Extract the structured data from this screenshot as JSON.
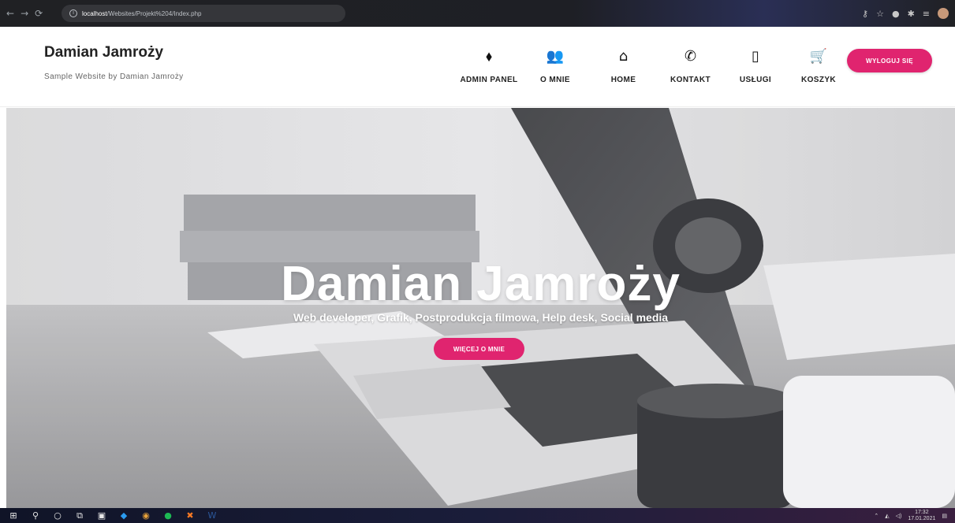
{
  "browser": {
    "nav": {
      "back": "←",
      "forward": "→",
      "reload": "⟳"
    },
    "url_host": "localhost",
    "url_path": "/Websites/Projekt%204/Index.php",
    "extension_icons": [
      "key-icon",
      "star-icon",
      "extension-icon",
      "puzzle-icon",
      "menu-icon",
      "profile-avatar"
    ]
  },
  "header": {
    "brand_title": "Damian Jamroży",
    "brand_subtitle": "Sample Website by Damian Jamroży",
    "nav": [
      {
        "label": "ADMIN PANEL",
        "icon": "tag-icon",
        "glyph": "⬧"
      },
      {
        "label": "O MNIE",
        "icon": "users-icon",
        "glyph": "👥"
      },
      {
        "label": "HOME",
        "icon": "home-icon",
        "glyph": "⌂"
      },
      {
        "label": "KONTAKT",
        "icon": "phone-icon",
        "glyph": "✆"
      },
      {
        "label": "USŁUGI",
        "icon": "mobile-icon",
        "glyph": "▯"
      },
      {
        "label": "KOSZYK",
        "icon": "cart-icon",
        "glyph": "🛒"
      }
    ],
    "logout_label": "WYLOGUJ SIĘ"
  },
  "hero": {
    "title": "Damian Jamroży",
    "subtitle": "Web developer, Grafik, Postprodukcja filmowa, Help desk, Social media",
    "button_label": "WIĘCEJ O MNIE"
  },
  "taskbar": {
    "time": "17:32",
    "date": "17.01.2021"
  },
  "colors": {
    "accent": "#e0246f",
    "header_bg": "#ffffff"
  }
}
